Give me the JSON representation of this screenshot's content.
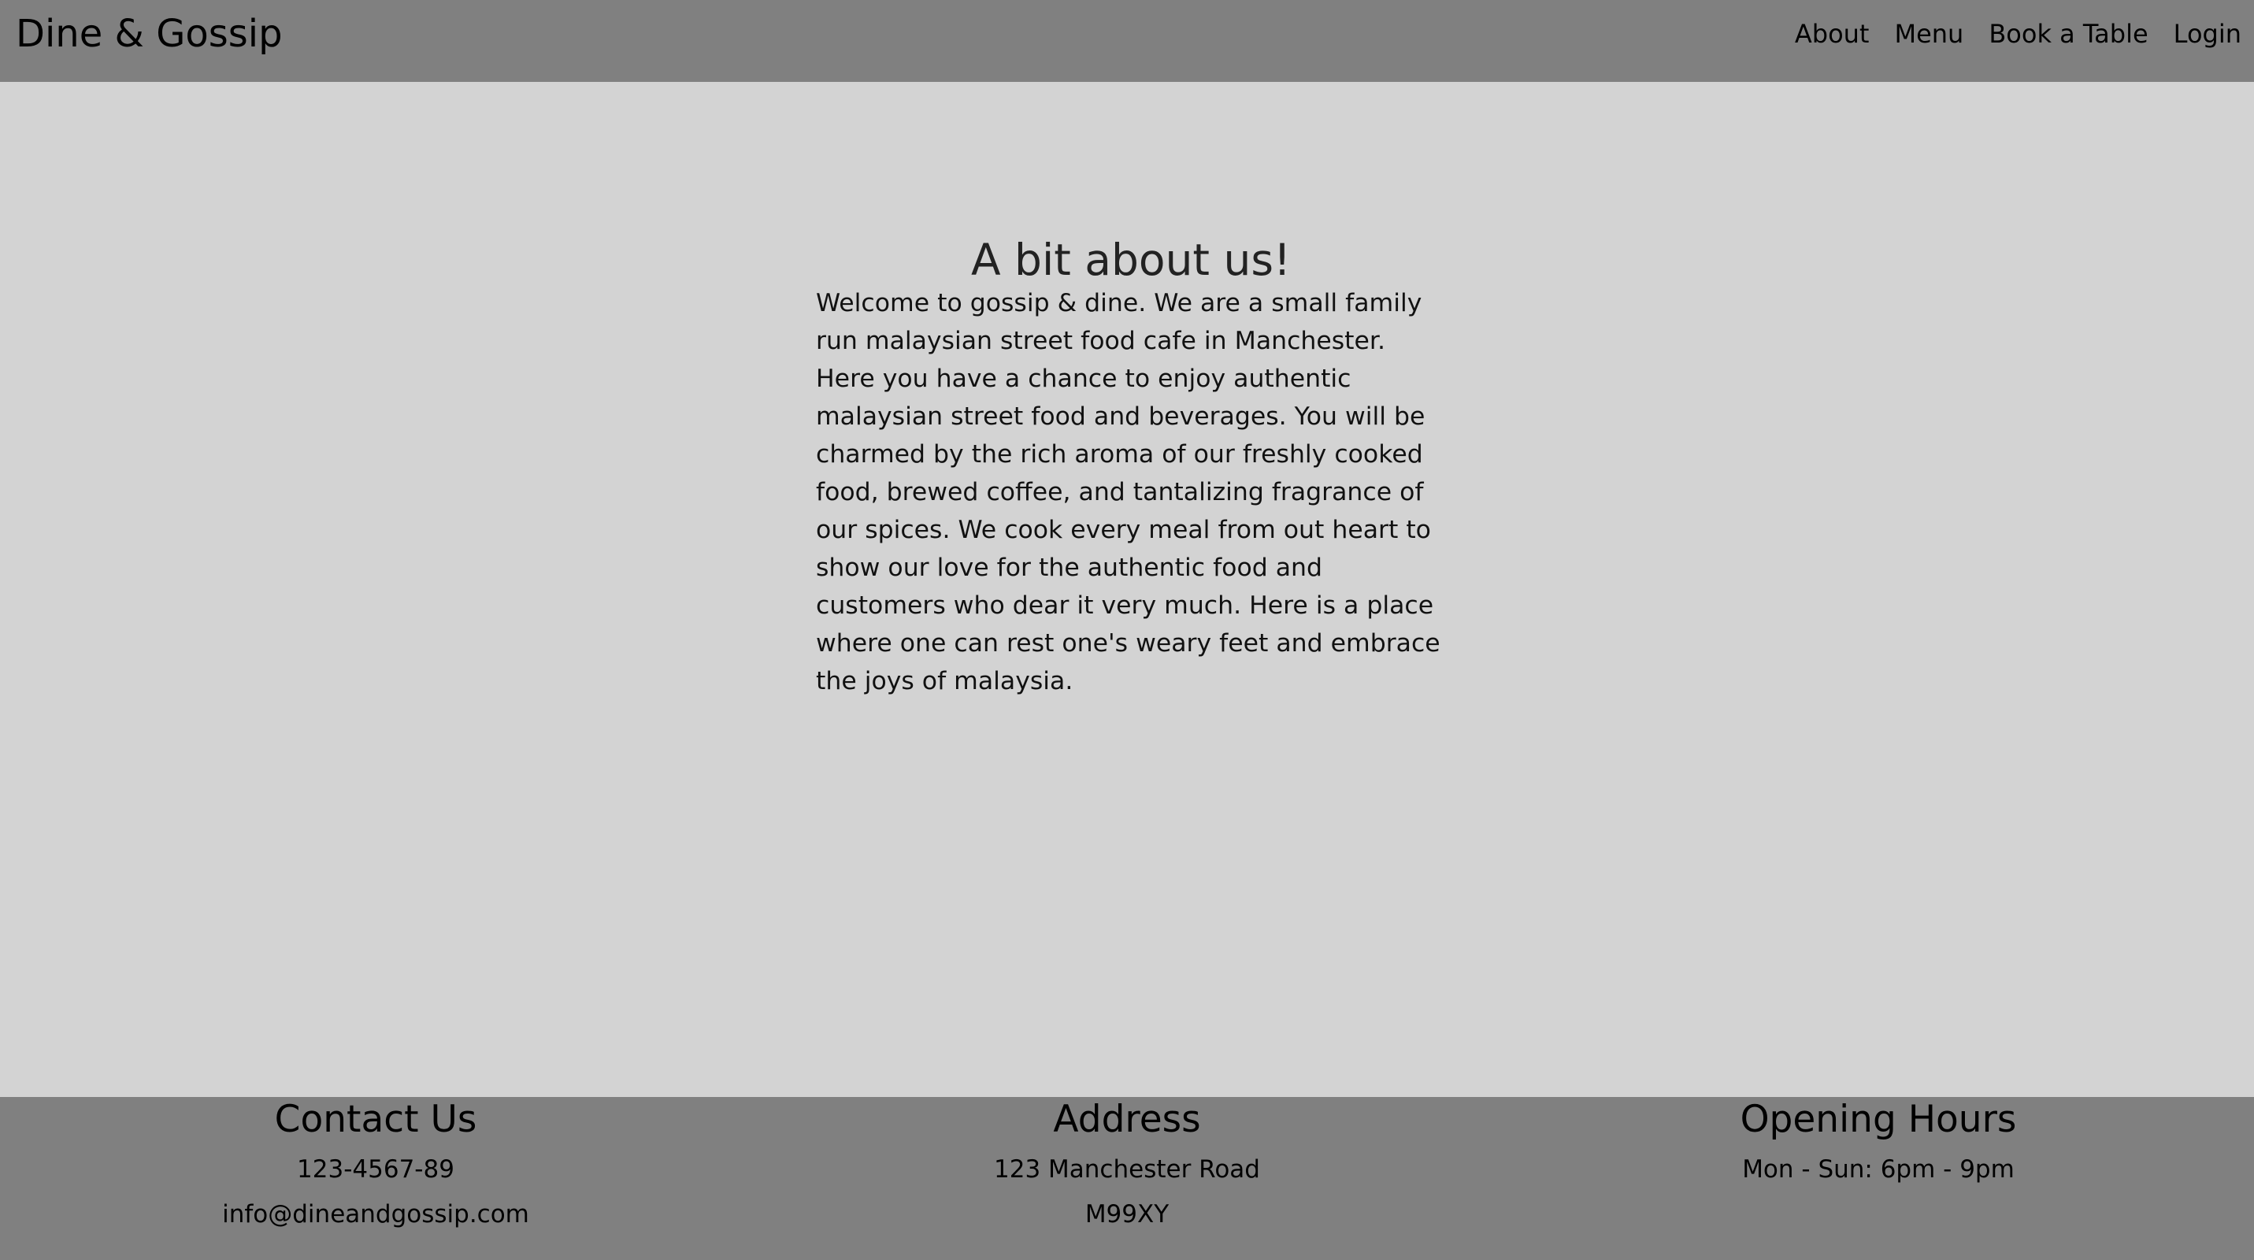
{
  "navbar": {
    "brand": "Dine & Gossip",
    "links": [
      "About",
      "Menu",
      "Book a Table",
      "Login"
    ]
  },
  "about": {
    "title": "A bit about us!",
    "text": "Welcome to gossip & dine. We are a small family run malaysian street food cafe in Manchester. Here you have a chance to enjoy authentic malaysian street food and beverages. You will be charmed by the rich aroma of our freshly cooked food, brewed coffee, and tantalizing fragrance of our spices. We cook every meal from out heart to show our love for the authentic food and customers who dear it very much. Here is a place where one can rest one's weary feet and embrace the joys of malaysia."
  },
  "footer": {
    "contact": {
      "title": "Contact Us",
      "phone": "123-4567-89",
      "email": "info@dineandgossip.com"
    },
    "address": {
      "title": "Address",
      "street": "123 Manchester Road",
      "postcode": "M99XY"
    },
    "hours": {
      "title": "Opening Hours",
      "times": "Mon - Sun: 6pm - 9pm"
    }
  },
  "colors": {
    "navbar_bg": "#808080",
    "page_bg": "#d3d3d3",
    "footer_bg": "#808080"
  }
}
